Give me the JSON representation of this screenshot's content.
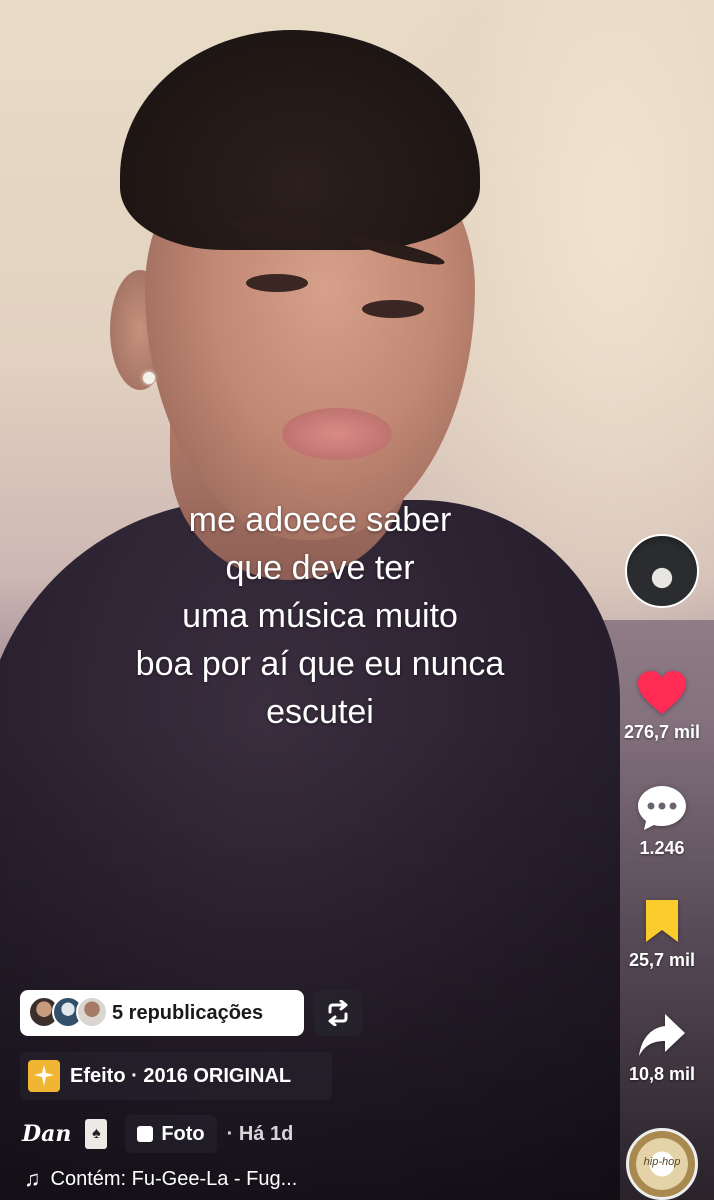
{
  "caption": {
    "lines": [
      "me adoece saber",
      "que deve ter",
      "uma música muito",
      "boa por aí que eu nunca",
      "escutei"
    ]
  },
  "actions": {
    "likes": "276,7 mil",
    "comments": "1.246",
    "saves": "25,7 mil",
    "shares": "10,8 mil",
    "like_color": "#fe2c55",
    "save_color": "#facd2d"
  },
  "reposts": {
    "label": "5 republicações"
  },
  "effect": {
    "label": "Efeito · 2016 ORIGINAL"
  },
  "author": {
    "username": "Dan",
    "post_type": "Foto",
    "age": "· Há 1d"
  },
  "music": {
    "label": "Contém: Fu-Gee-La - Fug..."
  },
  "disc": {
    "text": "hip-hop"
  }
}
